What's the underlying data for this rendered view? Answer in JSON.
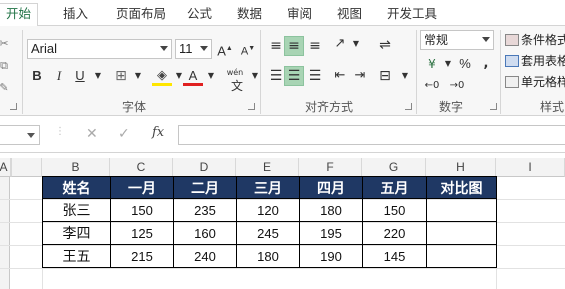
{
  "ribbon_tabs": [
    "开始",
    "插入",
    "页面布局",
    "公式",
    "数据",
    "审阅",
    "视图",
    "开发工具"
  ],
  "font": {
    "name": "Arial",
    "size": "11",
    "grow_label": "A",
    "shrink_label": "A",
    "bold": "B",
    "italic": "I",
    "underline": "U",
    "font_color_label": "A",
    "phonetic_label": "wén",
    "group_label": "字体"
  },
  "alignment": {
    "group_label": "对齐方式"
  },
  "number": {
    "format": "常规",
    "percent": "%",
    "comma": ",",
    "group_label": "数字"
  },
  "styles": {
    "conditional_formatting": "条件格式",
    "format_as_table": "套用表格",
    "cell_styles": "单元格样",
    "group_label": "样式"
  },
  "formula_bar": {
    "cancel": "✕",
    "enter": "✓",
    "fx": "fx",
    "value": ""
  },
  "columns": [
    "A",
    "B",
    "C",
    "D",
    "E",
    "F",
    "G",
    "H",
    "I"
  ],
  "table": {
    "headers": [
      "姓名",
      "一月",
      "二月",
      "三月",
      "四月",
      "五月",
      "对比图"
    ],
    "rows": [
      [
        "张三",
        "150",
        "235",
        "120",
        "180",
        "150",
        ""
      ],
      [
        "李四",
        "125",
        "160",
        "245",
        "195",
        "220",
        ""
      ],
      [
        "王五",
        "215",
        "240",
        "180",
        "190",
        "145",
        ""
      ]
    ]
  },
  "colors": {
    "accent": "#217346",
    "header_fill": "#1f3864",
    "active_button": "#a8d4b4"
  }
}
